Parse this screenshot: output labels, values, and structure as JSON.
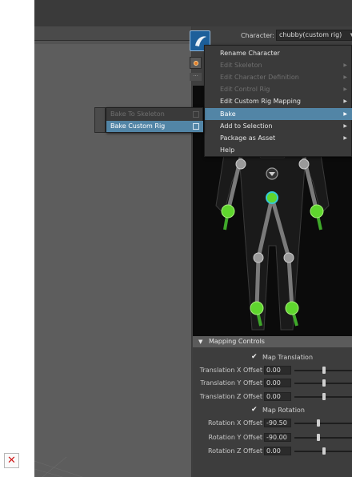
{
  "character": {
    "label": "Character:",
    "selected": "chubby(custom rig)"
  },
  "context_menu": {
    "items": [
      {
        "label": "Rename Character",
        "enabled": true,
        "submenu": false,
        "highlighted": false
      },
      {
        "label": "Edit Skeleton",
        "enabled": false,
        "submenu": true,
        "highlighted": false
      },
      {
        "label": "Edit Character Definition",
        "enabled": false,
        "submenu": true,
        "highlighted": false
      },
      {
        "label": "Edit Control Rig",
        "enabled": false,
        "submenu": true,
        "highlighted": false
      },
      {
        "label": "Edit Custom Rig Mapping",
        "enabled": true,
        "submenu": true,
        "highlighted": false
      },
      {
        "label": "Bake",
        "enabled": true,
        "submenu": true,
        "highlighted": true
      },
      {
        "label": "Add to Selection",
        "enabled": true,
        "submenu": true,
        "highlighted": false
      },
      {
        "label": "Package as Asset",
        "enabled": true,
        "submenu": true,
        "highlighted": false
      },
      {
        "label": "Help",
        "enabled": true,
        "submenu": false,
        "highlighted": false
      }
    ]
  },
  "bake_submenu": {
    "items": [
      {
        "label": "Bake To Skeleton",
        "enabled": false,
        "highlighted": false
      },
      {
        "label": "Bake Custom Rig",
        "enabled": true,
        "highlighted": true
      }
    ]
  },
  "mapping_controls": {
    "title": "Mapping Controls",
    "map_translation": {
      "label": "Map Translation",
      "checked": true
    },
    "map_rotation": {
      "label": "Map Rotation",
      "checked": true
    },
    "translation_rows": [
      {
        "label": "Translation X Offset",
        "value": "0.00",
        "slider": 0.5
      },
      {
        "label": "Translation Y Offset",
        "value": "0.00",
        "slider": 0.5
      },
      {
        "label": "Translation Z Offset",
        "value": "0.00",
        "slider": 0.5
      }
    ],
    "rotation_rows": [
      {
        "label": "Rotation X Offset",
        "value": "-90.50",
        "slider": 0.25
      },
      {
        "label": "Rotation Y Offset",
        "value": "-90.00",
        "slider": 0.25
      },
      {
        "label": "Rotation Z Offset",
        "value": "0.00",
        "slider": 0.5
      }
    ]
  },
  "icons": {
    "close": "close-icon",
    "character_logo": "humanik-logo-icon",
    "submenu_arrow": "submenu-arrow-icon",
    "checkmark": "checkmark-icon"
  },
  "colors": {
    "menu_highlight": "#5285a6",
    "effector_green": "#5fd62e",
    "hips_cyan": "#36c9d4"
  }
}
